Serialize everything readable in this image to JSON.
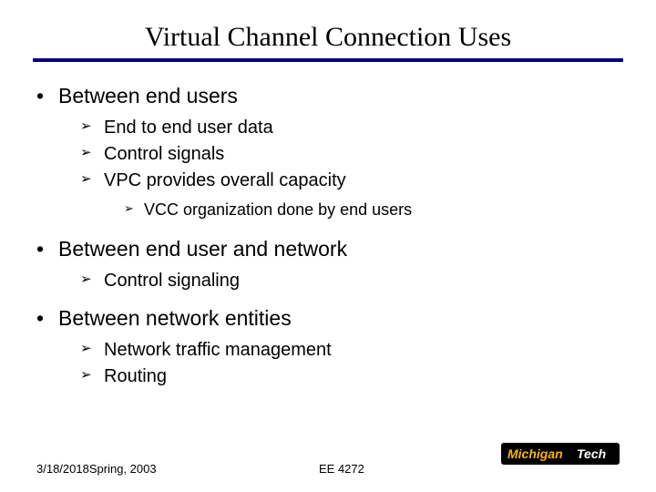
{
  "title": "Virtual Channel Connection Uses",
  "bullets": {
    "b1": "Between end users",
    "b1_1": "End to end user data",
    "b1_2": "Control signals",
    "b1_3": "VPC provides overall capacity",
    "b1_3_1": "VCC organization done by end users",
    "b2": "Between end user and network",
    "b2_1": "Control signaling",
    "b3": "Between network entities",
    "b3_1": "Network traffic management",
    "b3_2": "Routing"
  },
  "footer": {
    "date": "3/18/2018",
    "term": "Spring, 2003",
    "course": "EE 4272"
  },
  "logo": {
    "name": "MichiganTech"
  }
}
